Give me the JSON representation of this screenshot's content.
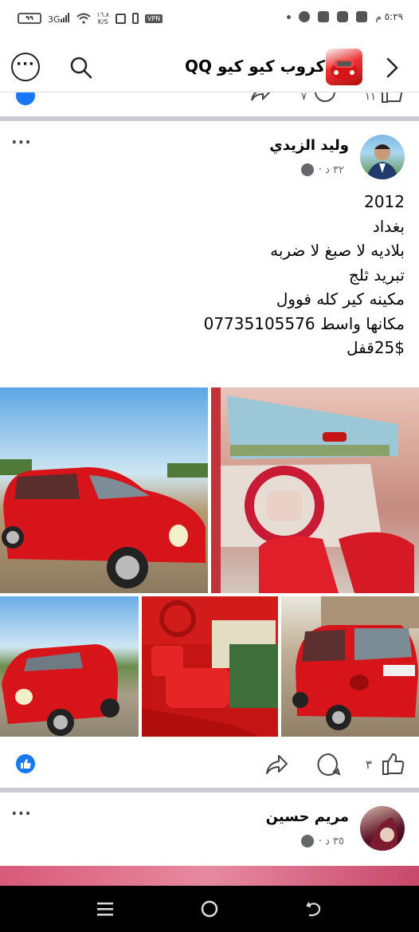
{
  "status_bar": {
    "battery": "٩٩",
    "network": "3G",
    "speed_value": "١٦.٨",
    "speed_unit": "K/S",
    "vpn": "VPN",
    "time": "٥:٢٩ م"
  },
  "header": {
    "group_title": "كروب كيو كيو QQ",
    "more_icon": "more-dots-icon",
    "search_icon": "search-icon",
    "back_icon": "chevron-right-icon"
  },
  "previous_post": {
    "comment_count": "٧",
    "like_count": "١١"
  },
  "post1": {
    "author": "وليد الزيدي",
    "time": "٣٢ د ·",
    "text_lines": [
      "2012",
      "بغداد",
      "بلاديه لا صبغ لا ضربه",
      "تبريد ثلج",
      "مكينه كير كله فوول",
      "مكانها واسط 07735105576",
      "25$قفل"
    ],
    "like_count": "٣",
    "colors": {
      "accent": "#1877f2",
      "car_red": "#d8141b"
    }
  },
  "post2": {
    "author": "مريم حسين",
    "time": "٣٥ د ·"
  },
  "nav": {
    "recents_icon": "recents-icon",
    "home_icon": "home-icon",
    "back_icon": "back-icon"
  }
}
